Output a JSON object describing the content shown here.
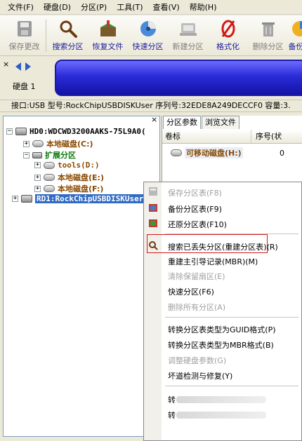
{
  "menubar": [
    "文件(F)",
    "硬盘(D)",
    "分区(P)",
    "工具(T)",
    "查看(V)",
    "帮助(H)"
  ],
  "toolbar": [
    {
      "label": "保存更改",
      "icon": "save-icon",
      "enabled": false
    },
    {
      "label": "搜索分区",
      "icon": "search-icon",
      "enabled": true
    },
    {
      "label": "恢复文件",
      "icon": "restore-file-icon",
      "enabled": true
    },
    {
      "label": "快速分区",
      "icon": "quick-partition-icon",
      "enabled": true
    },
    {
      "label": "新建分区",
      "icon": "new-partition-icon",
      "enabled": false
    },
    {
      "label": "格式化",
      "icon": "format-icon",
      "enabled": true
    },
    {
      "label": "删除分区",
      "icon": "delete-icon",
      "enabled": false
    },
    {
      "label": "备份分",
      "icon": "backup-icon",
      "enabled": true
    }
  ],
  "diskbar": {
    "close": "×",
    "disk_label": "硬盘 1"
  },
  "infoline": "接口:USB  型号:RockChipUSBDISKUser  序列号:32EDE8A249DECCF0  容量:3.",
  "tree": {
    "close": "×",
    "items": [
      {
        "text": "HD0:WDCWD3200AAKS-75L9A0(",
        "kind": "disk",
        "expander": "−"
      },
      {
        "text": "本地磁盘(C:)",
        "kind": "partition",
        "expander": "+"
      },
      {
        "text": "扩展分区",
        "kind": "extended",
        "expander": "−"
      },
      {
        "text": "tools(D:)",
        "kind": "partition",
        "expander": "+"
      },
      {
        "text": "本地磁盘(E:)",
        "kind": "partition",
        "expander": "+"
      },
      {
        "text": "本地磁盘(F:)",
        "kind": "partition",
        "expander": "+"
      },
      {
        "text": "RD1:RockChipUSBDISKUser",
        "kind": "disk-selected",
        "expander": "+"
      }
    ]
  },
  "tabs": [
    "分区参数",
    "浏览文件"
  ],
  "list": {
    "columns": [
      "卷标",
      "序号(状"
    ],
    "rows": [
      {
        "label": "可移动磁盘(H:)",
        "number": "0"
      }
    ]
  },
  "context_menu": [
    {
      "label": "保存分区表(F8)",
      "enabled": false,
      "icon": "save-table-icon"
    },
    {
      "label": "备份分区表(F9)",
      "enabled": true,
      "icon": "backup-table-icon"
    },
    {
      "label": "还原分区表(F10)",
      "enabled": true,
      "icon": "restore-table-icon"
    },
    {
      "label": "搜索已丢失分区(重建分区表)(R)",
      "enabled": true,
      "icon": "search-icon",
      "highlighted": true
    },
    {
      "label": "重建主引导记录(MBR)(M)",
      "enabled": true
    },
    {
      "label": "清除保留扇区(E)",
      "enabled": false
    },
    {
      "label": "快速分区(F6)",
      "enabled": true
    },
    {
      "label": "删除所有分区(A)",
      "enabled": false
    },
    {
      "label": "转换分区表类型为GUID格式(P)",
      "enabled": true
    },
    {
      "label": "转换分区表类型为MBR格式(B)",
      "enabled": true
    },
    {
      "label": "调整硬盘参数(G)",
      "enabled": false
    },
    {
      "label": "坏道检测与修复(Y)",
      "enabled": true
    },
    {
      "label": "转",
      "enabled": true
    },
    {
      "label": "转",
      "enabled": true
    }
  ],
  "colors": {
    "selection": "#316ac5",
    "highlight_box": "#d21a1a",
    "volume_bar": "#2b2bd8",
    "partition_text": "#8a4a00",
    "extended_text": "#0a7a0a"
  }
}
